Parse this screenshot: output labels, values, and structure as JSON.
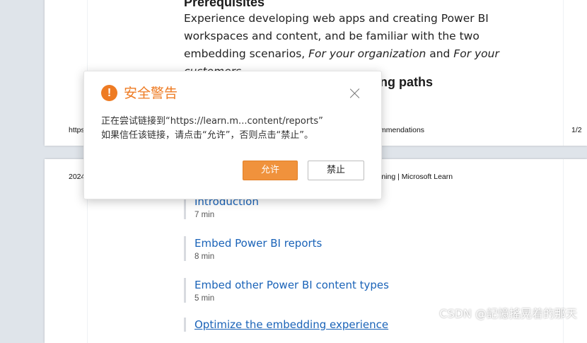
{
  "page1": {
    "heading": "Prerequisites",
    "paragraph": {
      "text1": "Experience developing web apps and creating Power BI workspaces and content, and be familiar with the two embedding scenarios, ",
      "italic1": "For your organization",
      "text2": " and ",
      "italic2": "For your customers",
      "text3": "."
    },
    "next_heading_visible": "ing paths",
    "footer_left": "https",
    "footer_mid": "mmendations",
    "footer_right": "1/2"
  },
  "page2": {
    "header_left": "2024",
    "header_mid": "ining | Microsoft Learn",
    "modules": [
      {
        "title": "Introduction",
        "time": "7 min"
      },
      {
        "title": "Embed Power BI reports",
        "time": "8 min"
      },
      {
        "title": "Embed other Power BI content types",
        "time": "5 min"
      },
      {
        "title": "Optimize the embedding experience",
        "time": ""
      }
    ]
  },
  "dialog": {
    "icon": "warning-icon",
    "title": "安全警告",
    "message_line1": "正在尝试链接到“https://learn.m...content/reports”",
    "message_line2": "如果信任该链接，请点击“允许”，否则点击“禁止”。",
    "allow_label": "允许",
    "deny_label": "禁止"
  },
  "watermark": "CSDN @記憶搖晃着的那天",
  "colors": {
    "accent": "#ee7b23",
    "link": "#1a63b8",
    "background": "#dfe4ea"
  }
}
